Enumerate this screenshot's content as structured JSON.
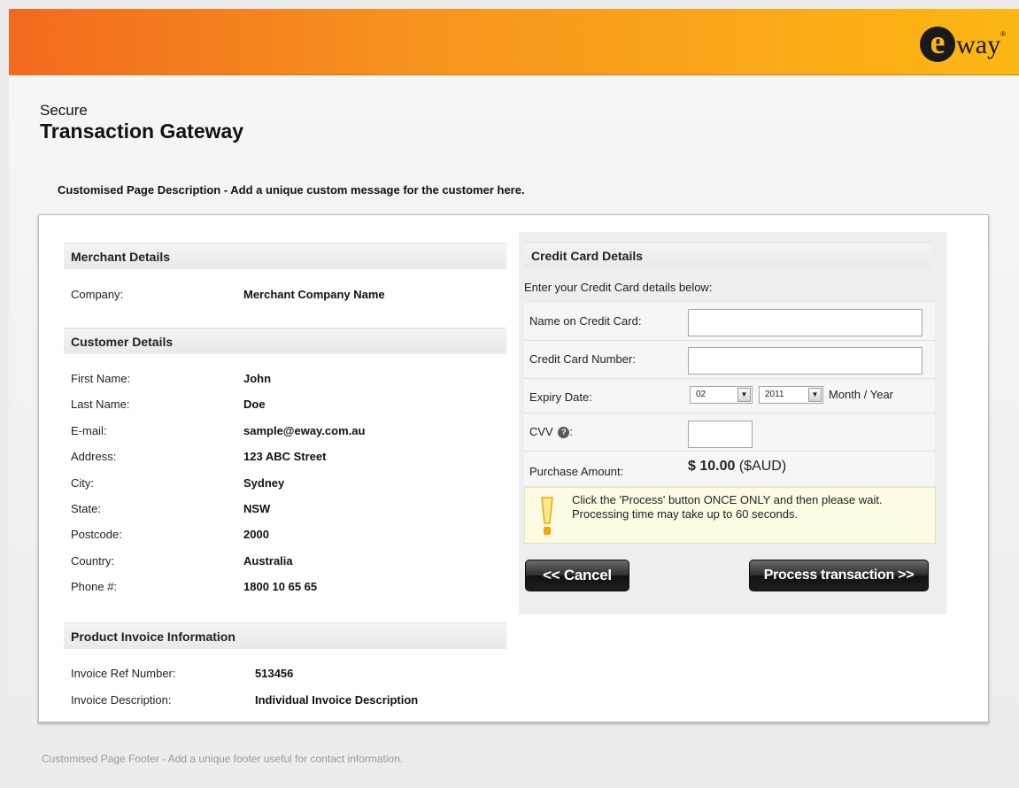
{
  "brand": {
    "logo_letter": "e",
    "logo_text": "way",
    "logo_reg": "®"
  },
  "title": {
    "line1": "Secure",
    "line2": "Transaction Gateway"
  },
  "description": "Customised Page Description - Add a unique custom message for the customer here.",
  "merchant": {
    "heading": "Merchant Details",
    "rows": [
      {
        "label": "Company:",
        "value": "Merchant Company Name"
      }
    ]
  },
  "customer": {
    "heading": "Customer Details",
    "rows": [
      {
        "label": "First Name:",
        "value": "John"
      },
      {
        "label": "Last Name:",
        "value": "Doe"
      },
      {
        "label": "E-mail:",
        "value": "sample@eway.com.au"
      },
      {
        "label": "Address:",
        "value": "123 ABC Street"
      },
      {
        "label": "City:",
        "value": "Sydney"
      },
      {
        "label": "State:",
        "value": "NSW"
      },
      {
        "label": "Postcode:",
        "value": "2000"
      },
      {
        "label": "Country:",
        "value": "Australia"
      },
      {
        "label": "Phone #:",
        "value": "1800 10 65 65"
      }
    ]
  },
  "invoice": {
    "heading": "Product Invoice Information",
    "rows": [
      {
        "label": "Invoice Ref Number:",
        "value": "513456"
      },
      {
        "label": "Invoice Description:",
        "value": "Individual Invoice Description"
      }
    ]
  },
  "card": {
    "heading": "Credit Card Details",
    "intro": "Enter your Credit Card details below:",
    "name_label": "Name on Credit Card:",
    "name_value": "",
    "number_label": "Credit Card Number:",
    "number_value": "",
    "expiry_label": "Expiry Date:",
    "expiry_month": "02",
    "expiry_year": "2011",
    "expiry_hint": "Month / Year",
    "cvv_label_prefix": "CVV",
    "cvv_label_suffix": ":",
    "cvv_value": "",
    "amount_label": "Purchase Amount:",
    "amount_value": "$ 10.00",
    "amount_currency": "($AUD)"
  },
  "notice": {
    "line1": "Click the 'Process' button ONCE ONLY and then please wait.",
    "line2": "Processing time may take up to 60 seconds."
  },
  "buttons": {
    "cancel": "<< Cancel",
    "process": "Process transaction >>"
  },
  "footer": "Customised Page Footer - Add a unique footer useful for contact information.",
  "colors": {
    "accent_orange": "#f7931e",
    "accent_yellow": "#fdb813",
    "button_dark": "#1f1f1f"
  }
}
